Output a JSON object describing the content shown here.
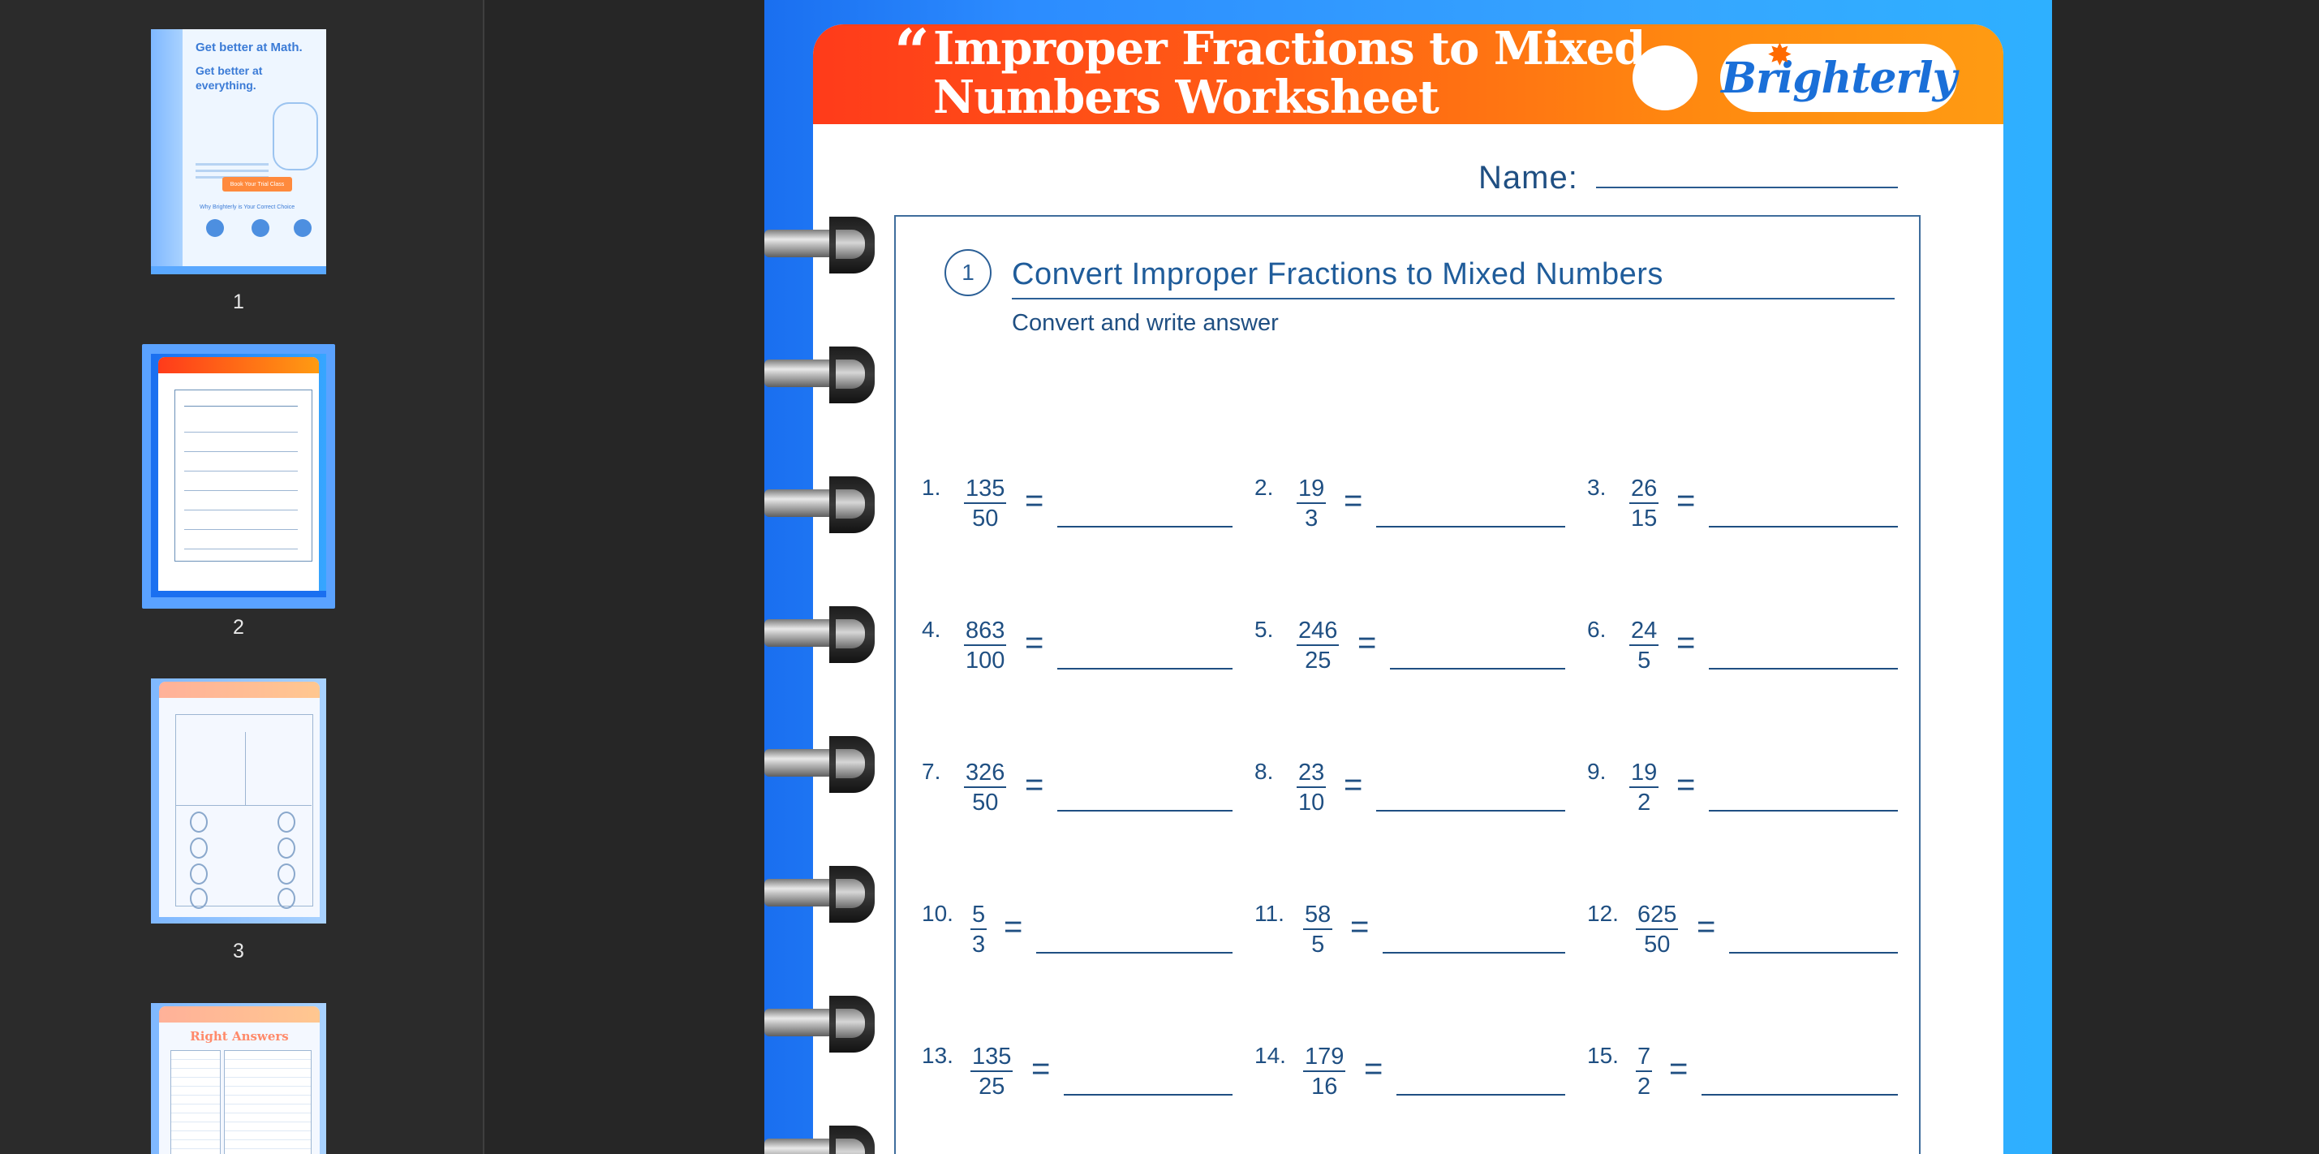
{
  "sidebar": {
    "thumbnails": [
      {
        "page": "1",
        "heading": "Get better at Math.",
        "subheading": "Get better at everything.",
        "cta": "Book Your Trial Class",
        "footer": "Why Brighterly is Your Correct Choice"
      },
      {
        "page": "2",
        "selected": true
      },
      {
        "page": "3"
      },
      {
        "page": "4",
        "heading": "Right Answers"
      }
    ]
  },
  "worksheet": {
    "quote_mark": "“",
    "title_line1": "Improper Fractions to Mixed",
    "title_line2": "Numbers Worksheet",
    "logo": "Brighterly",
    "name_label": "Name:",
    "section_number": "1",
    "section_title": "Convert Improper Fractions to Mixed Numbers",
    "section_subtitle": "Convert and write answer",
    "equals": "=",
    "problems": [
      {
        "label": "1.",
        "numerator": "135",
        "denominator": "50"
      },
      {
        "label": "2.",
        "numerator": "19",
        "denominator": "3"
      },
      {
        "label": "3.",
        "numerator": "26",
        "denominator": "15"
      },
      {
        "label": "4.",
        "numerator": "863",
        "denominator": "100"
      },
      {
        "label": "5.",
        "numerator": "246",
        "denominator": "25"
      },
      {
        "label": "6.",
        "numerator": "24",
        "denominator": "5"
      },
      {
        "label": "7.",
        "numerator": "326",
        "denominator": "50"
      },
      {
        "label": "8.",
        "numerator": "23",
        "denominator": "10"
      },
      {
        "label": "9.",
        "numerator": "19",
        "denominator": "2"
      },
      {
        "label": "10.",
        "numerator": "5",
        "denominator": "3"
      },
      {
        "label": "11.",
        "numerator": "58",
        "denominator": "5"
      },
      {
        "label": "12.",
        "numerator": "625",
        "denominator": "50"
      },
      {
        "label": "13.",
        "numerator": "135",
        "denominator": "25"
      },
      {
        "label": "14.",
        "numerator": "179",
        "denominator": "16"
      },
      {
        "label": "15.",
        "numerator": "7",
        "denominator": "2"
      }
    ]
  },
  "colors": {
    "banner_start": "#ff3b1a",
    "banner_end": "#ff9b12",
    "page_blue": "#2c8cff",
    "text_blue": "#1f4f82",
    "selection_border": "#5aa2ff"
  }
}
